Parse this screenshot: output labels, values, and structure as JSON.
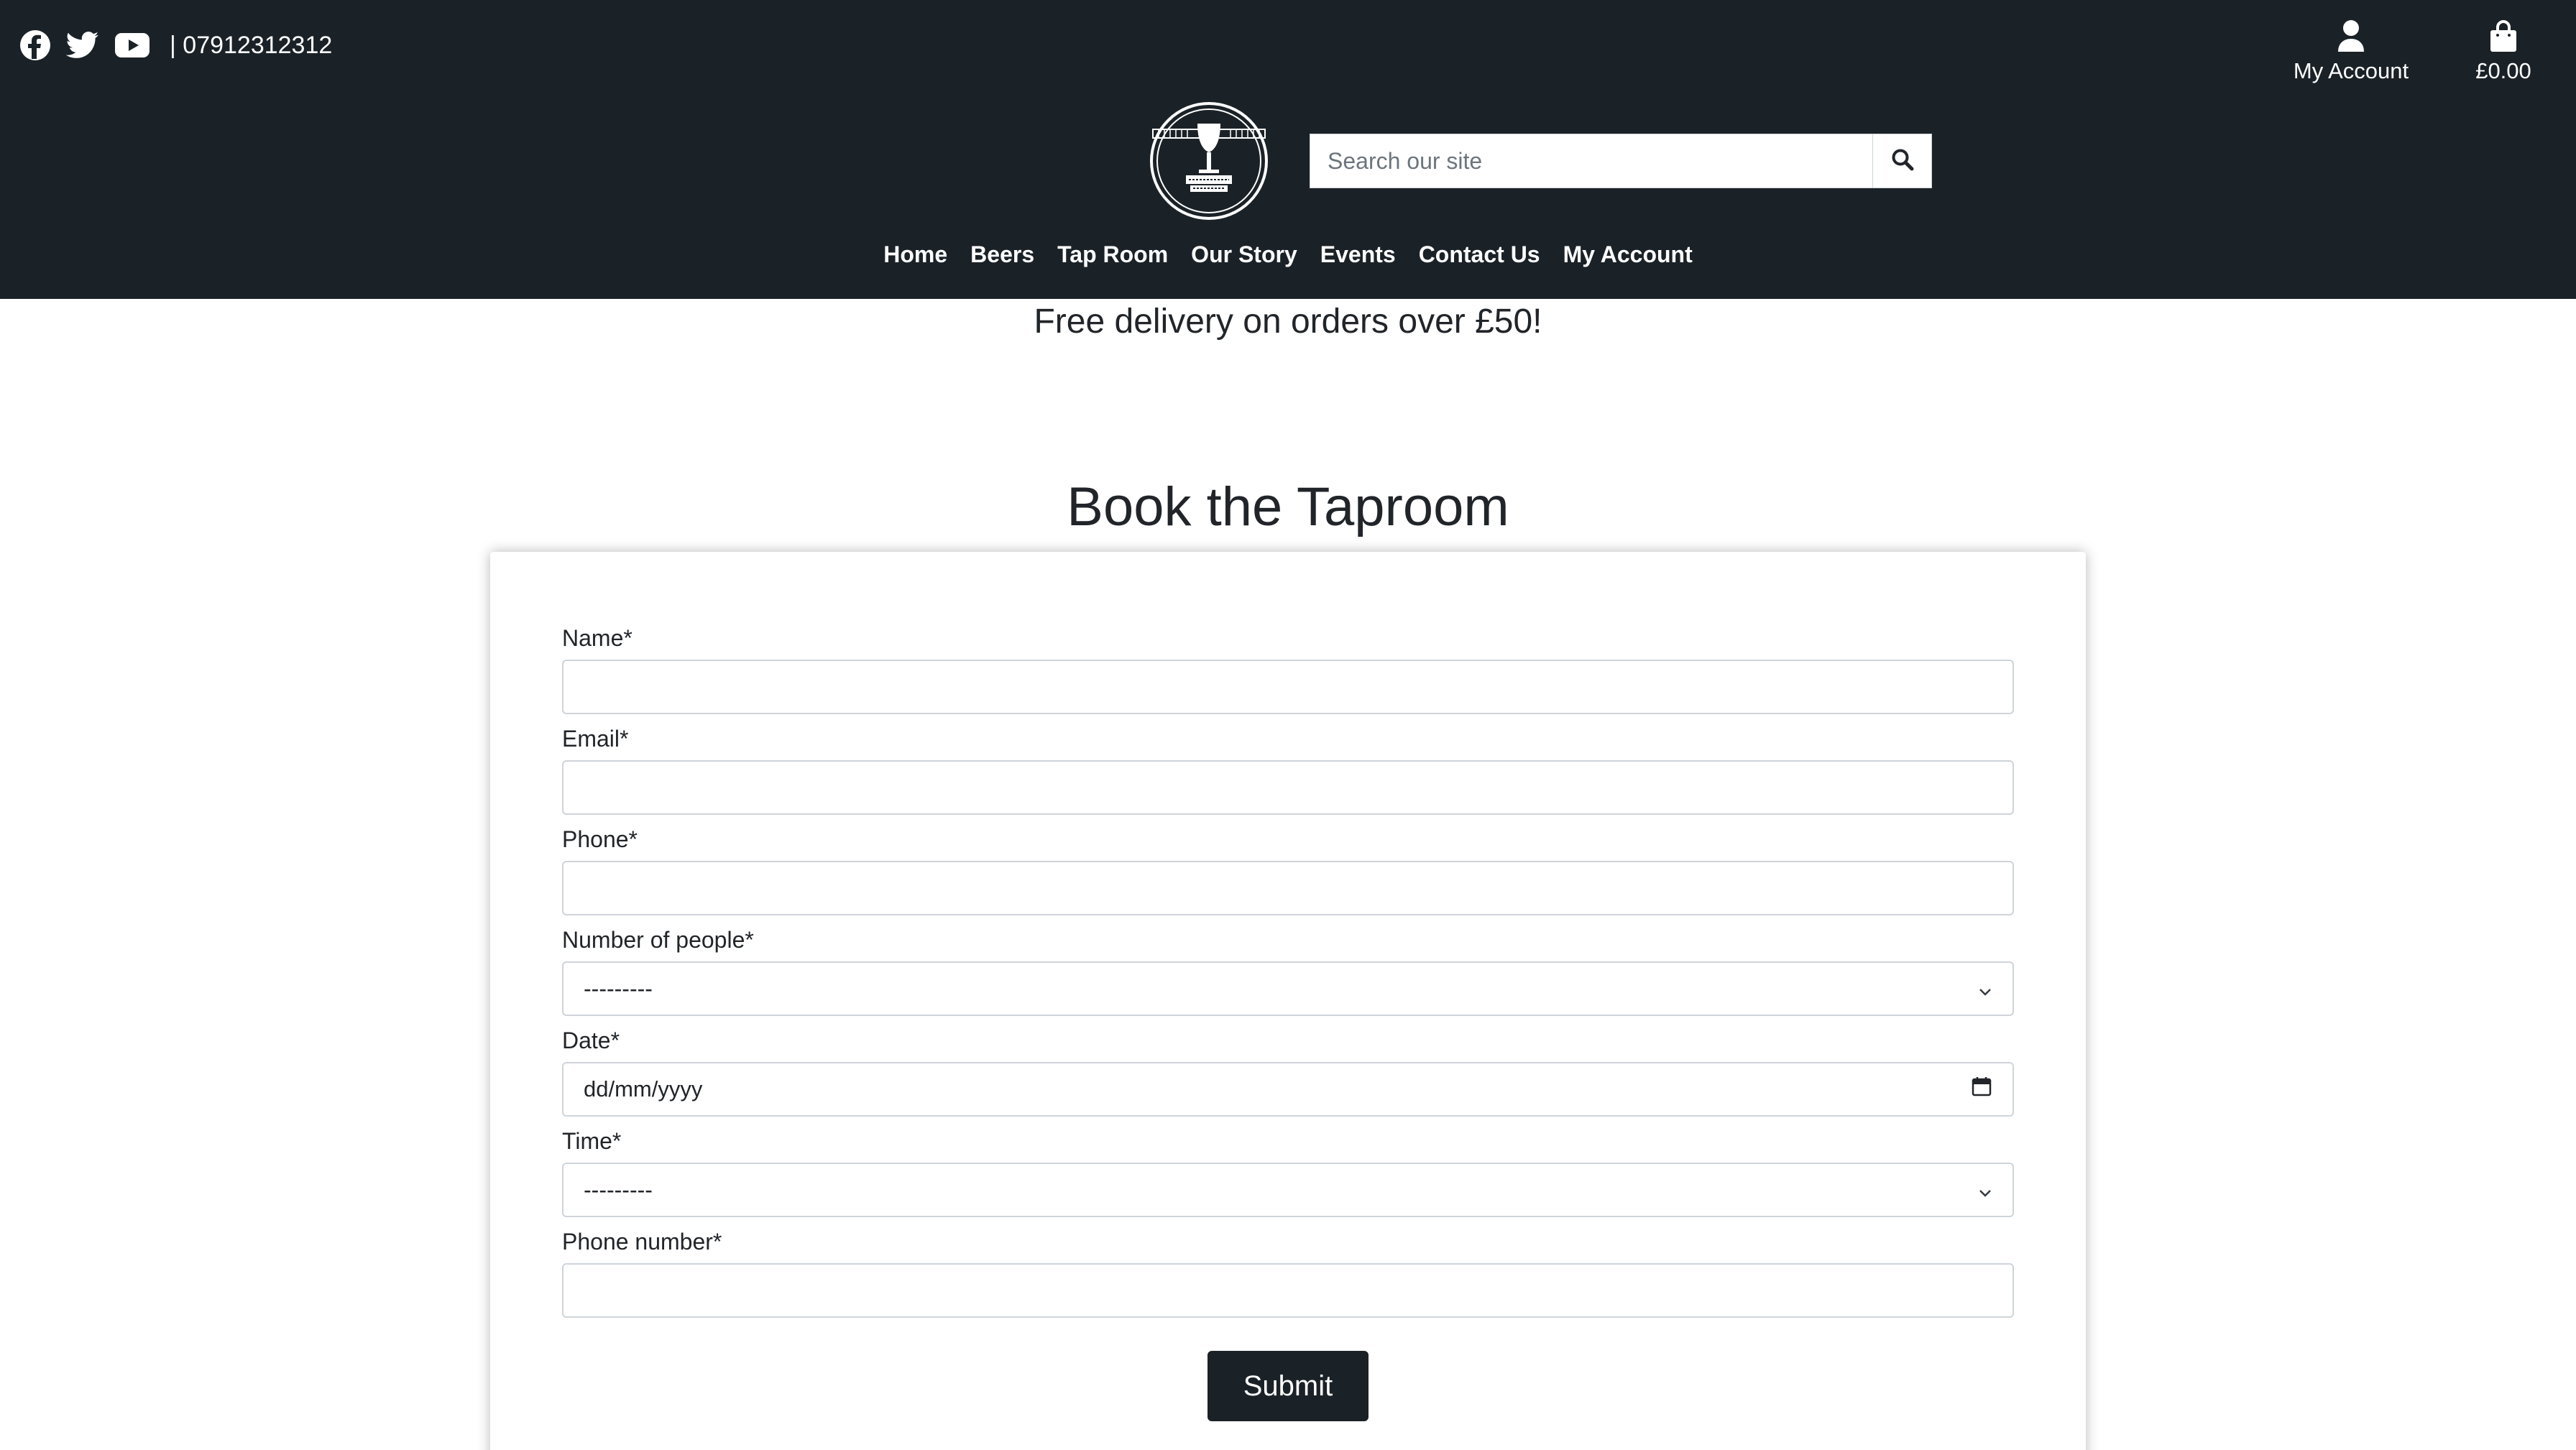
{
  "header": {
    "social_icons": [
      "facebook-icon",
      "twitter-icon",
      "youtube-icon"
    ],
    "phone": "| 07912312312",
    "my_account_label": "My Account",
    "basket_total": "£0.00",
    "search": {
      "placeholder": "Search our site",
      "value": ""
    },
    "logo_icon": "brewery-logo-glass",
    "nav": [
      "Home",
      "Beers",
      "Tap Room",
      "Our Story",
      "Events",
      "Contact Us",
      "My Account"
    ]
  },
  "banner": "Free delivery on orders over £50!",
  "page_title": "Book the Taproom",
  "form": {
    "name_label": "Name*",
    "name_value": "",
    "email_label": "Email*",
    "email_value": "",
    "phone_label": "Phone*",
    "phone_value": "",
    "people_label": "Number of people*",
    "people_value": "---------",
    "date_label": "Date*",
    "date_value": "dd/mm/yyyy",
    "time_label": "Time*",
    "time_value": "---------",
    "phone_number_label": "Phone number*",
    "phone_number_value": "",
    "submit_label": "Submit"
  },
  "colors": {
    "header_bg": "#1b2227",
    "text": "#212529",
    "button_bg": "#1b2227"
  }
}
